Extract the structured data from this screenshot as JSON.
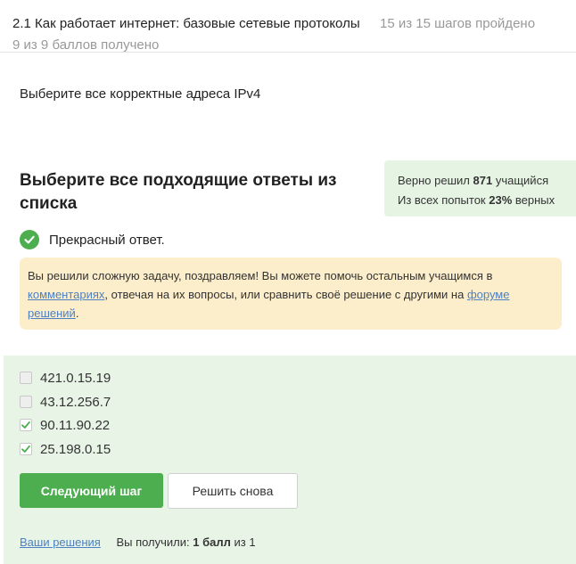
{
  "header": {
    "lesson_title": "2.1 Как работает интернет: базовые сетевые протоколы",
    "progress": "15 из 15 шагов пройдено",
    "score": "9 из 9 баллов  получено"
  },
  "question": "Выберите все корректные адреса IPv4",
  "instruction": "Выберите все подходящие ответы из списка",
  "stats": {
    "solved_prefix": "Верно решил",
    "solved_count": "871",
    "solved_suffix": "учащийся",
    "attempts_prefix": "Из всех попыток",
    "attempts_percent": "23%",
    "attempts_suffix": "верных"
  },
  "result": {
    "icon": "check-circle-icon",
    "text": "Прекрасный ответ."
  },
  "notice": {
    "part1": "Вы решили сложную задачу, поздравляем! Вы можете помочь остальным учащимся в ",
    "link_comments": "комментариях",
    "part2": ", отвечая на их вопросы, или сравнить своё решение с другими на ",
    "link_forum": "форуме решений",
    "part3": "."
  },
  "options": [
    {
      "label": "421.0.15.19",
      "checked": false
    },
    {
      "label": "43.12.256.7",
      "checked": false
    },
    {
      "label": "90.11.90.22",
      "checked": true
    },
    {
      "label": "25.198.0.15",
      "checked": true
    }
  ],
  "buttons": {
    "next": "Следующий шаг",
    "retry": "Решить снова"
  },
  "footer": {
    "your_solutions": "Ваши решения",
    "received_prefix": "Вы получили:",
    "received_value": "1 балл",
    "received_suffix": "из 1"
  },
  "colors": {
    "accent_green": "#4cae4f",
    "panel_green": "#e8f5e6",
    "notice_bg": "#fdeecb",
    "link_blue": "#4d80c2"
  }
}
